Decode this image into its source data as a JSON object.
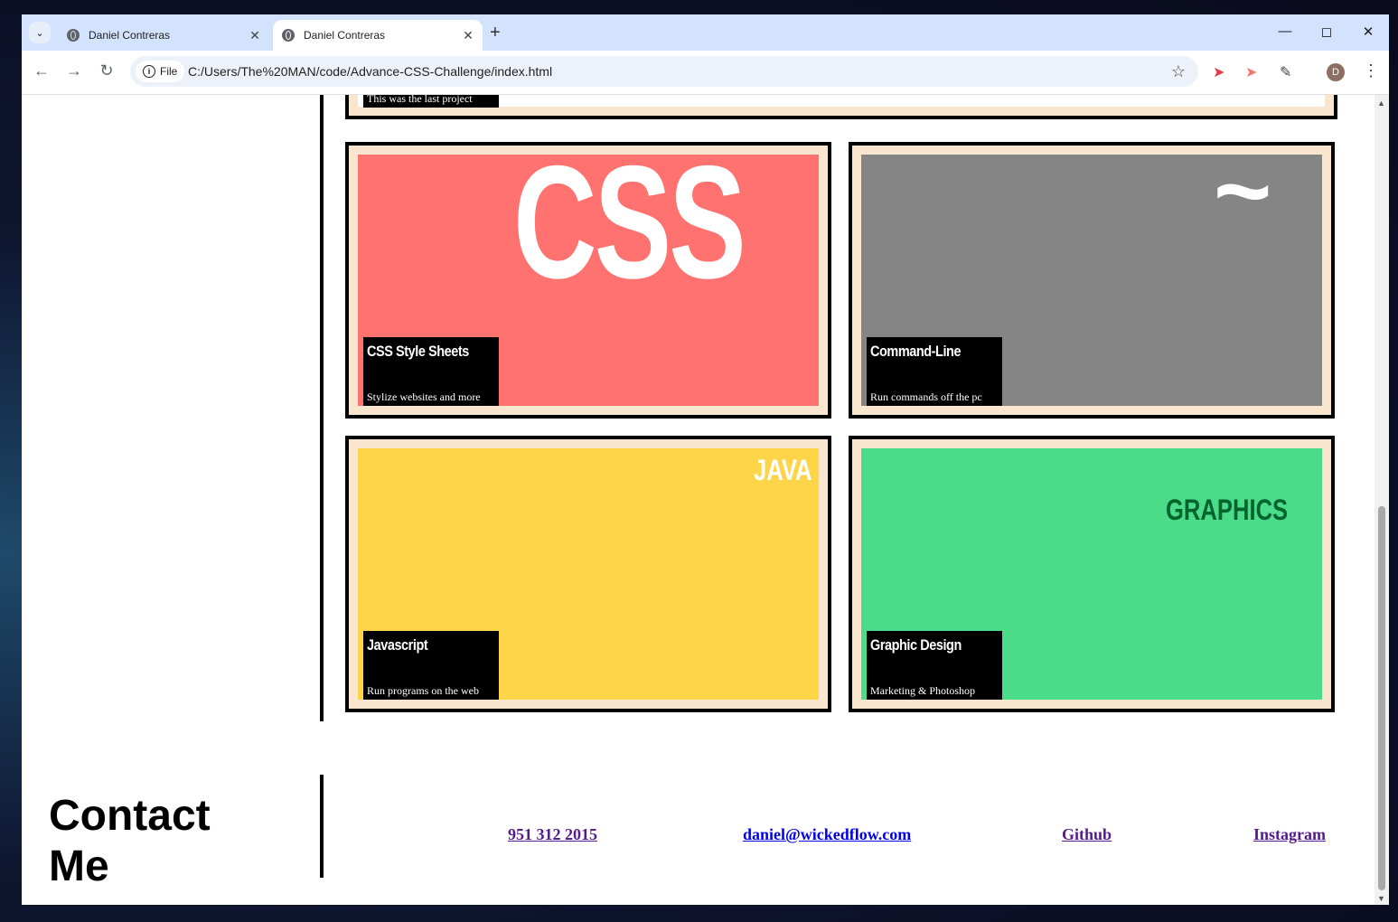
{
  "browser": {
    "tabs": [
      {
        "title": "Daniel Contreras",
        "active": false
      },
      {
        "title": "Daniel Contreras",
        "active": true
      }
    ],
    "address_chip": "File",
    "url": "C:/Users/The%20MAN/code/Advance-CSS-Challenge/index.html",
    "profile_initial": "D"
  },
  "page": {
    "last_project_caption": "This was the last project",
    "cards": [
      {
        "big_text": "CSS",
        "title": "CSS Style Sheets",
        "subtitle": "Stylize websites and more",
        "bg": "#ff7270",
        "big_color": "#ffffff"
      },
      {
        "big_text": "~",
        "title": "Command-Line",
        "subtitle": "Run commands off the pc",
        "bg": "#858585",
        "big_color": "#ffffff"
      },
      {
        "big_text": "JAVA",
        "title": "Javascript",
        "subtitle": "Run programs on the web",
        "bg": "#fed449",
        "big_color": "#ffffff"
      },
      {
        "big_text": "GRAPHICS",
        "title": "Graphic Design",
        "subtitle": "Marketing & Photoshop",
        "bg": "#4adc89",
        "big_color": "#04642e"
      }
    ],
    "contact": {
      "title_line1": "Contact",
      "title_line2": "Me",
      "phone": "951 312 2015",
      "email": "daniel@wickedflow.com",
      "github": "Github",
      "instagram": "Instagram"
    },
    "colors": {
      "card_border": "#000000",
      "card_frame": "#fae6ce",
      "link_visited": "#551a8b",
      "link": "#0000ee"
    }
  }
}
